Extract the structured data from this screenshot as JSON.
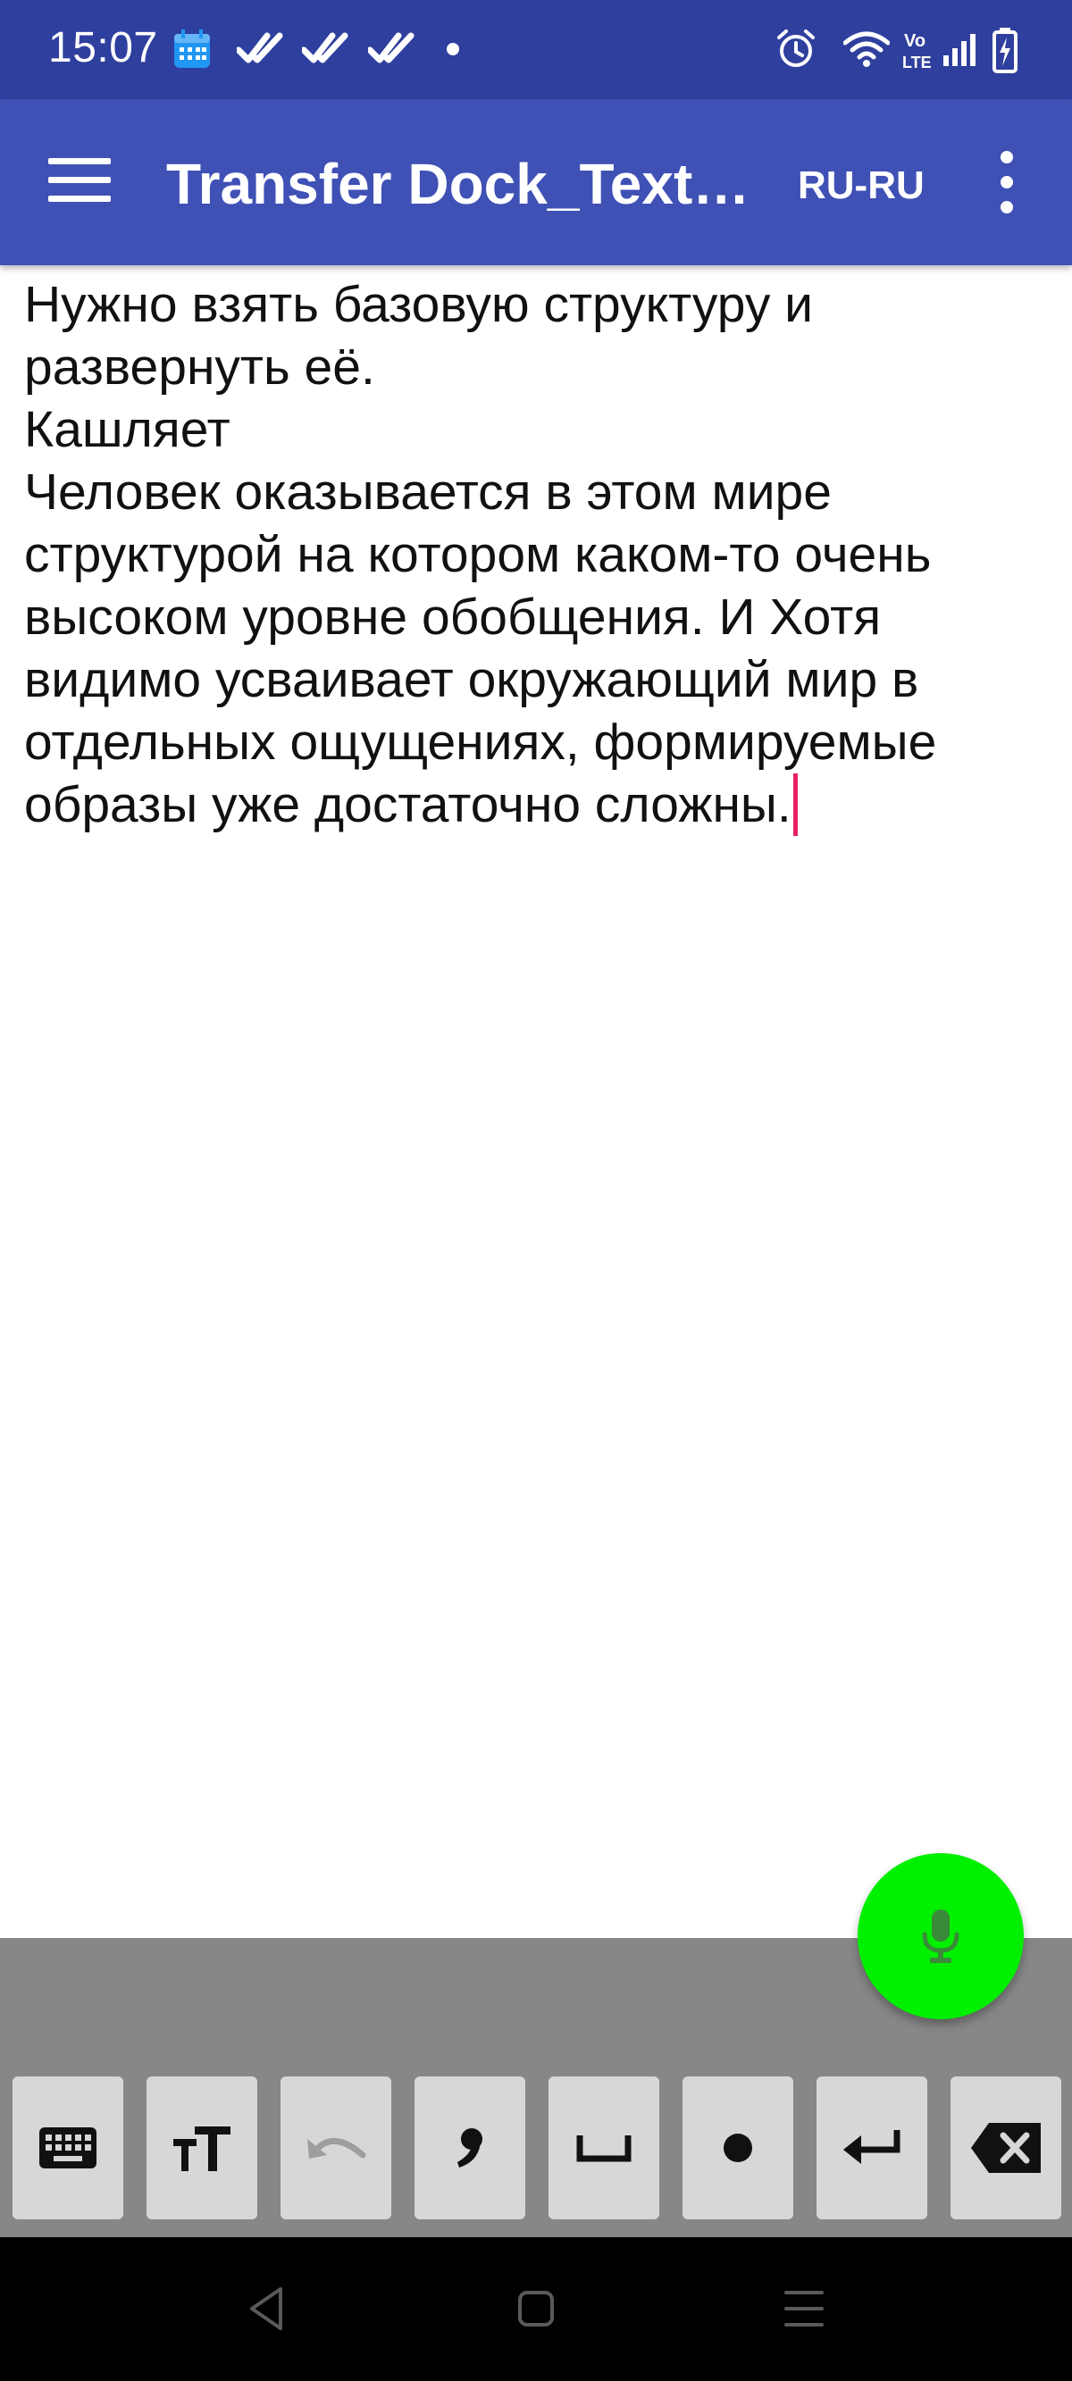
{
  "status_bar": {
    "time": "15:07",
    "icons": [
      "calendar-icon",
      "double-check-icon",
      "double-check-icon",
      "double-check-icon",
      "dot-icon",
      "alarm-icon",
      "wifi-icon",
      "volte-icon",
      "signal-icon",
      "battery-charging-icon"
    ],
    "volte_label": "Vo\nLTE"
  },
  "app_bar": {
    "title": "Transfer Dock_Text_...",
    "language": "RU-RU",
    "background": "#3f51b5",
    "status_background": "#2f3f9e"
  },
  "editor": {
    "lines": [
      "Нужно взять базовую структуру и развернуть её.",
      "Кашляет",
      "Человек оказывается в этом мире структурой на котором каком-то очень высоком уровне обобщения. И Хотя видимо усваивает окружающий мир в отдельных ощущениях, формируемые образы уже достаточно сложны."
    ],
    "cursor_color": "#e91e63"
  },
  "fab": {
    "icon": "microphone-icon",
    "color": "#00f000"
  },
  "toolbar": {
    "keys": [
      {
        "name": "keyboard-key",
        "icon": "keyboard-icon"
      },
      {
        "name": "text-size-key",
        "icon": "text-size-icon"
      },
      {
        "name": "undo-key",
        "icon": "undo-icon"
      },
      {
        "name": "comma-key",
        "icon": "comma-icon"
      },
      {
        "name": "space-key",
        "icon": "space-icon"
      },
      {
        "name": "period-key",
        "icon": "period-icon"
      },
      {
        "name": "enter-key",
        "icon": "enter-icon"
      },
      {
        "name": "backspace-key",
        "icon": "backspace-icon"
      }
    ]
  },
  "nav_bar": {
    "icons": [
      "back-icon",
      "home-icon",
      "menu-icon"
    ]
  }
}
